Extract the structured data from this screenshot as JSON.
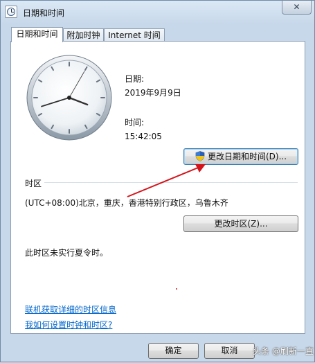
{
  "window": {
    "title": "日期和时间",
    "close_glyph": "✕"
  },
  "tabs": [
    {
      "label": "日期和时间",
      "active": true
    },
    {
      "label": "附加时钟",
      "active": false
    },
    {
      "label": "Internet 时间",
      "active": false
    }
  ],
  "clock_display": {
    "hour": 15,
    "minute": 42,
    "second": 5
  },
  "date": {
    "label": "日期:",
    "value": "2019年9月9日"
  },
  "time": {
    "label": "时间:",
    "value": "15:42:05"
  },
  "change_datetime_button": {
    "label": "更改日期和时间(D)..."
  },
  "timezone": {
    "heading": "时区",
    "value": "(UTC+08:00)北京，重庆，香港特别行政区，乌鲁木齐",
    "change_button": "更改时区(Z)...",
    "dst_note": "此时区未实行夏令时。"
  },
  "links": {
    "online_info": "联机获取详细的时区信息",
    "how_to": "我如何设置时钟和时区?"
  },
  "footer": {
    "ok": "确定",
    "cancel": "取消"
  },
  "watermark": {
    "text": "头条 @刷新一直"
  },
  "colors": {
    "annotation_arrow": "#d4141b",
    "link": "#0066cc"
  },
  "icons": {
    "window": "clock-icon",
    "close": "close-icon",
    "uac": "uac-shield-icon",
    "link": "help-link-icon"
  }
}
